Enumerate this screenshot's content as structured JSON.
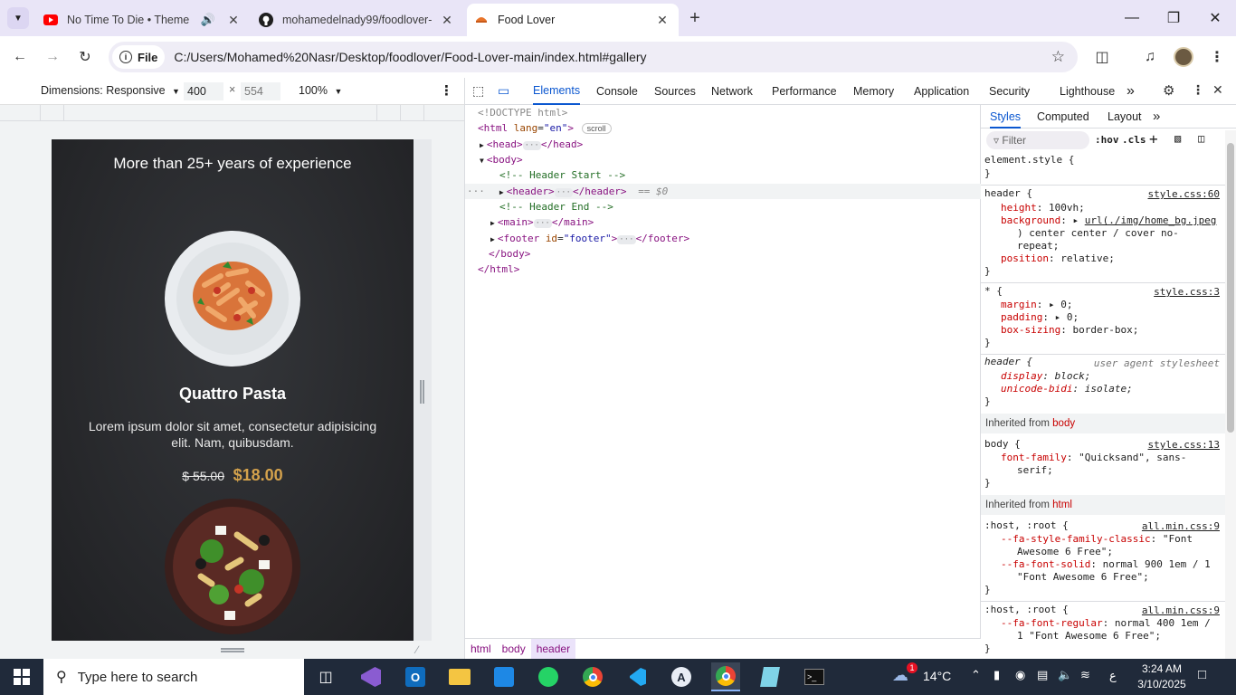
{
  "tabs": [
    {
      "title": "No Time To Die • Theme So",
      "favicon": "youtube-icon"
    },
    {
      "title": "mohamedelnady99/foodlover-",
      "favicon": "github-icon"
    },
    {
      "title": "Food Lover",
      "favicon": "food-lover-icon"
    }
  ],
  "toolbar": {
    "info_label": "File",
    "url": "C:/Users/Mohamed%20Nasr/Desktop/foodlover/Food-Lover-main/index.html#gallery"
  },
  "device": {
    "dimensions_label": "Dimensions: Responsive",
    "width": "400",
    "height_placeholder": "554",
    "zoom": "100%"
  },
  "site": {
    "heading": "More than 25+ years of experience",
    "dish_name": "Quattro Pasta",
    "dish_desc": "Lorem ipsum dolor sit amet, consectetur adipisicing elit. Nam, quibusdam.",
    "old_price": "$ 55.00",
    "new_price": "$18.00"
  },
  "devtools": {
    "tabs": [
      "Elements",
      "Console",
      "Sources",
      "Network",
      "Performance",
      "Memory",
      "Application",
      "Security",
      "Lighthouse"
    ],
    "more": "»"
  },
  "dom": {
    "doctype": "<!DOCTYPE html>",
    "html_open": "<html",
    "lang_attr": "lang",
    "lang_val": "\"en\"",
    "scroll_badge": "scroll",
    "head": "<head>",
    "head_close": "</head>",
    "body": "<body>",
    "cmt_header_start": "<!-- Header Start -->",
    "header": "<header>",
    "header_close": "</header>",
    "selected_marker": "== $0",
    "cmt_header_end": "<!-- Header End -->",
    "main": "<main>",
    "main_close": "</main>",
    "footer_open": "<footer",
    "footer_attr": "id",
    "footer_val": "\"footer\"",
    "footer_close": "</footer>",
    "body_close": "</body>",
    "html_close": "</html>"
  },
  "breadcrumbs": [
    "html",
    "body",
    "header"
  ],
  "styles": {
    "tabs": [
      "Styles",
      "Computed",
      "Layout"
    ],
    "filter_placeholder": "Filter",
    "hov": ":hov",
    "cls": ".cls",
    "rules": {
      "element_style": "element.style {",
      "close": "}",
      "header_selector": "header {",
      "header_src": "style.css:60",
      "height_prop": "height",
      "height_val": "100vh;",
      "bg_prop": "background",
      "bg_val_1": "url(./img/home_bg.jpeg",
      "bg_val_2": ") center center / cover no-",
      "bg_val_3": "repeat;",
      "pos_prop": "position",
      "pos_val": "relative;",
      "star_selector": "* {",
      "star_src": "style.css:3",
      "margin_prop": "margin",
      "margin_val": "0;",
      "padding_prop": "padding",
      "padding_val": "0;",
      "boxsizing_prop": "box-sizing",
      "boxsizing_val": "border-box;",
      "ua_selector": "header {",
      "ua_src": "user agent stylesheet",
      "display_prop": "display",
      "display_val": "block;",
      "unicode_prop": "unicode-bidi",
      "unicode_val": "isolate;",
      "inherited_body": "Inherited from",
      "inherited_body_el": "body",
      "body_selector": "body {",
      "body_src": "style.css:13",
      "ff_prop": "font-family",
      "ff_val_1": "\"Quicksand\", sans-",
      "ff_val_2": "serif;",
      "inherited_html": "Inherited from",
      "inherited_html_el": "html",
      "host_selector": ":host, :root {",
      "host_src": "all.min.css:9",
      "fa1_prop": "--fa-style-family-classic",
      "fa1_val_1": "\"Font",
      "fa1_val_2": "Awesome 6 Free\";",
      "fa2_prop": "--fa-font-solid",
      "fa2_val_1": "normal 900 1em / 1",
      "fa2_val_2": "\"Font Awesome 6 Free\";",
      "host2_selector": ":host, :root {",
      "host2_src": "all.min.css:9",
      "fa3_prop": "--fa-font-regular",
      "fa3_val_1": "normal 400 1em /",
      "fa3_val_2": "1 \"Font Awesome 6 Free\";"
    }
  },
  "taskbar": {
    "search_placeholder": "Type here to search",
    "weather": "14°C",
    "weather_badge": "1",
    "lang": "ع",
    "time": "3:24 AM",
    "date": "3/10/2025"
  },
  "colors": {
    "accent_blue": "#0b57d0",
    "price_gold": "#d4a24c",
    "taskbar_bg": "#202a3a"
  }
}
